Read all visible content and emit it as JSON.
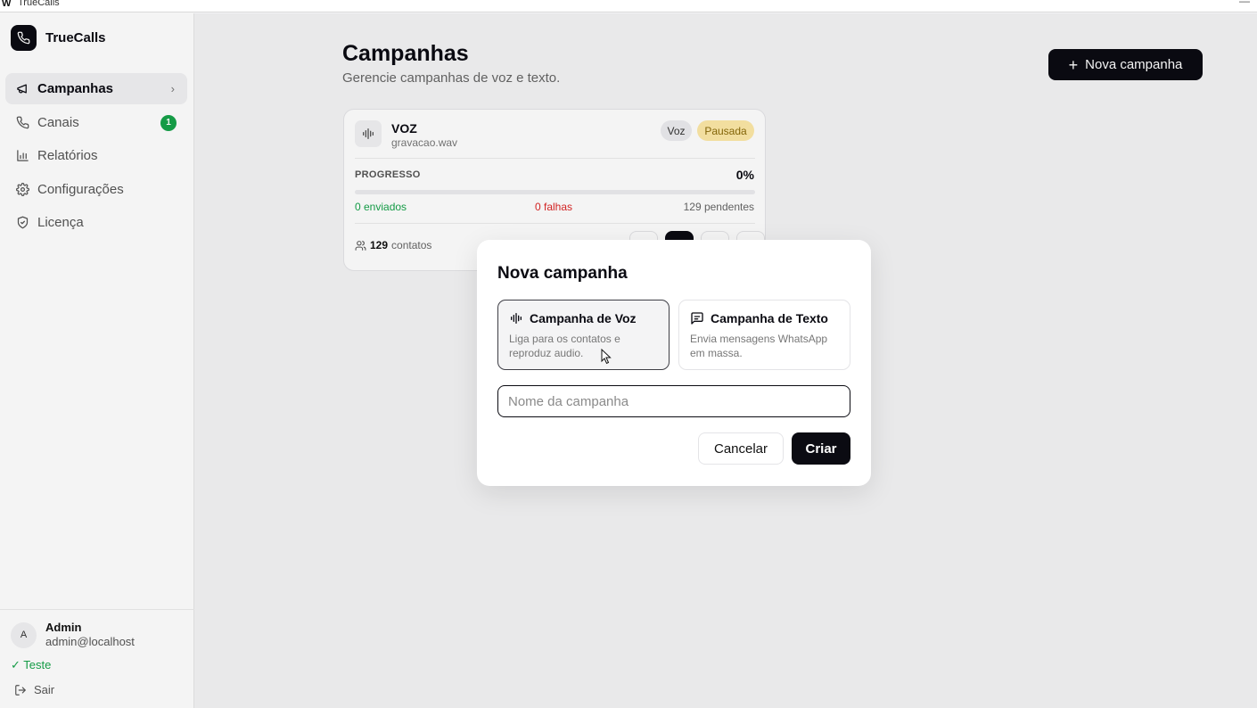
{
  "window": {
    "title": "TrueCalls",
    "app_glyph": "W",
    "minimize_glyph": "—"
  },
  "brand": {
    "name": "TrueCalls",
    "logo_icon": "phone-icon"
  },
  "sidebar": {
    "items": [
      {
        "label": "Campanhas",
        "icon": "megaphone-icon",
        "active": true,
        "chevron": "›"
      },
      {
        "label": "Canais",
        "icon": "phone-icon",
        "badge": "1"
      },
      {
        "label": "Relatórios",
        "icon": "bar-chart-icon"
      },
      {
        "label": "Configurações",
        "icon": "gear-icon"
      },
      {
        "label": "Licença",
        "icon": "shield-icon"
      }
    ],
    "user": {
      "initial": "A",
      "name": "Admin",
      "email": "admin@localhost"
    },
    "license_status": "✓ Teste",
    "logout_label": "Sair"
  },
  "main": {
    "title": "Campanhas",
    "subtitle": "Gerencie campanhas de voz e texto.",
    "new_button_label": "Nova campanha",
    "campaign": {
      "name": "VOZ",
      "file": "gravacao.wav",
      "type_tag": "Voz",
      "status_tag": "Pausada",
      "progress_label": "PROGRESSO",
      "progress_percent": 0,
      "progress_text": "0%",
      "sent": "0 enviados",
      "failed": "0 falhas",
      "pending": "129 pendentes",
      "contacts_count": "129",
      "contacts_label": "contatos"
    }
  },
  "modal": {
    "title": "Nova campanha",
    "options": [
      {
        "title": "Campanha de Voz",
        "desc": "Liga para os contatos e reproduz audio.",
        "icon": "audio-wave-icon",
        "selected": true
      },
      {
        "title": "Campanha de Texto",
        "desc": "Envia mensagens WhatsApp em massa.",
        "icon": "message-icon",
        "selected": false
      }
    ],
    "name_placeholder": "Nome da campanha",
    "name_value": "",
    "cancel_label": "Cancelar",
    "create_label": "Criar"
  },
  "colors": {
    "primary": "#0b0b12",
    "success": "#16a34a",
    "danger": "#dc2626",
    "paused_bg": "#fde9a7",
    "paused_text": "#8a6a0a"
  }
}
